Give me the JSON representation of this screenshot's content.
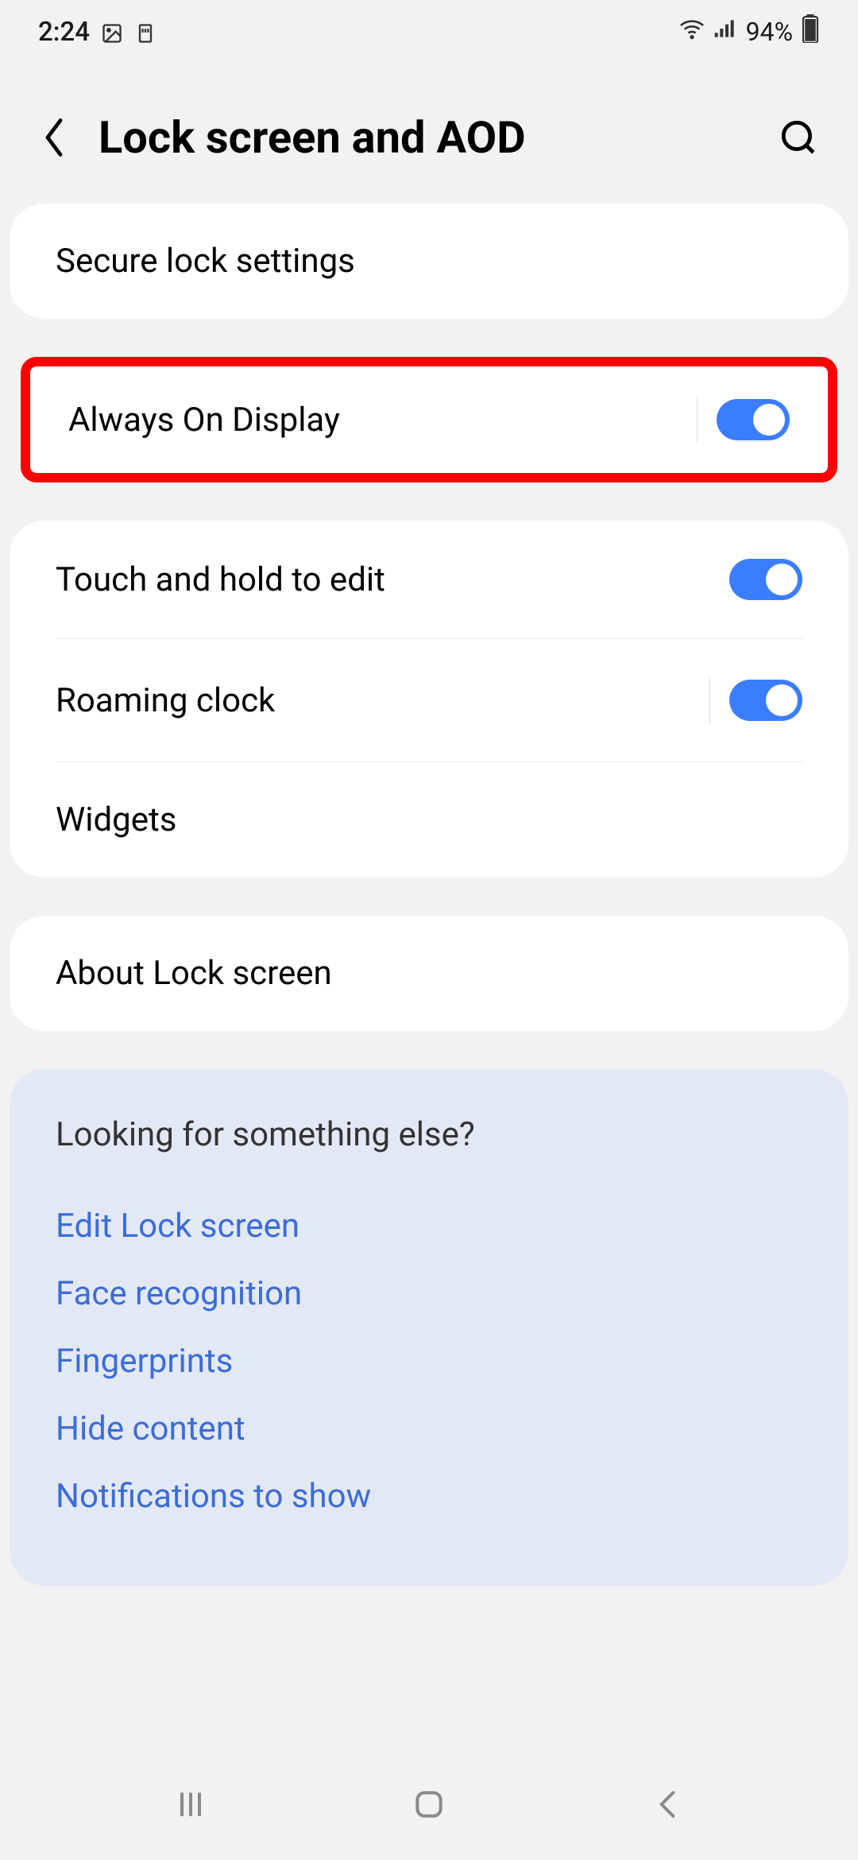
{
  "status_bar": {
    "time": "2:24",
    "battery_percent": "94%"
  },
  "header": {
    "title": "Lock screen and AOD"
  },
  "card_secure": {
    "label": "Secure lock settings"
  },
  "card_aod": {
    "label": "Always On Display",
    "toggle_on": true
  },
  "card_options": {
    "touch_edit": "Touch and hold to edit",
    "roaming_clock": "Roaming clock",
    "widgets": "Widgets"
  },
  "card_about": {
    "label": "About Lock screen"
  },
  "suggestions": {
    "title": "Looking for something else?",
    "links": [
      "Edit Lock screen",
      "Face recognition",
      "Fingerprints",
      "Hide content",
      "Notifications to show"
    ]
  }
}
